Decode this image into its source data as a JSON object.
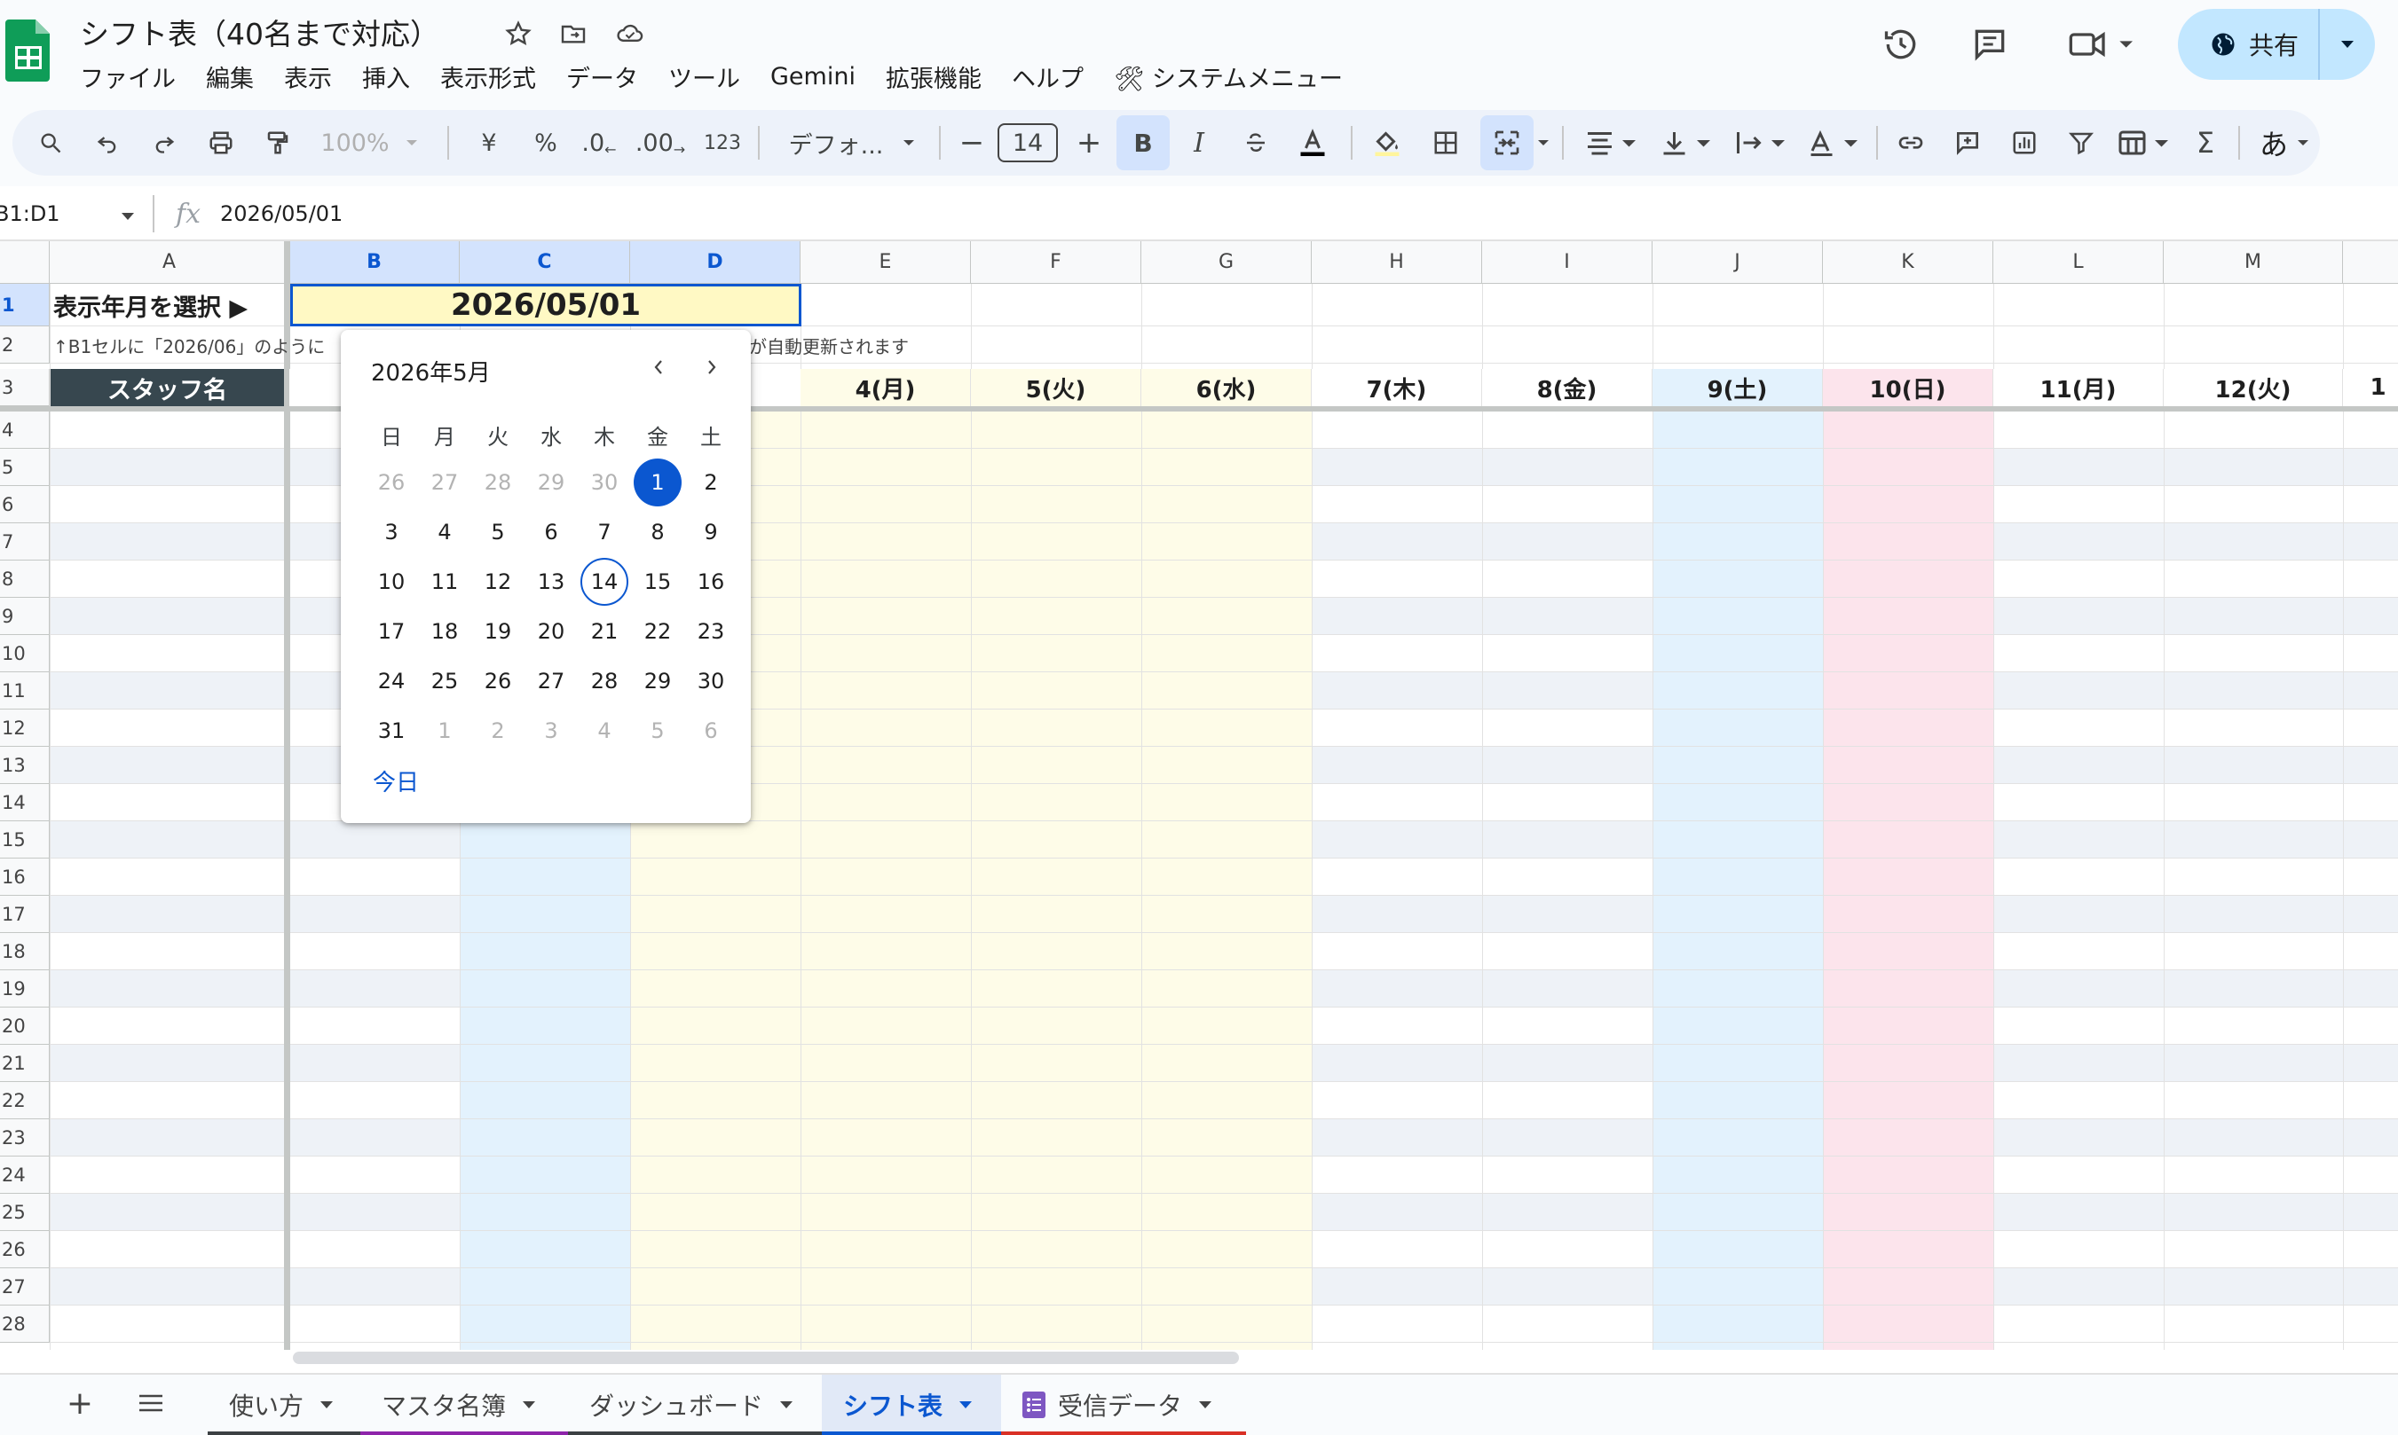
{
  "title": "シフト表（40名まで対応）",
  "menu": [
    "ファイル",
    "編集",
    "表示",
    "挿入",
    "表示形式",
    "データ",
    "ツール",
    "Gemini",
    "拡張機能",
    "ヘルプ",
    "🛠 システムメニュー"
  ],
  "share_label": "共有",
  "toolbar": {
    "zoom": "100%",
    "currency": "¥",
    "percent": "%",
    "dec_decrease": ".0",
    "dec_increase": ".00",
    "number_format": "123",
    "font": "デフォ...",
    "font_size": "14",
    "bold": "B",
    "italic": "I",
    "input_tool": "あ"
  },
  "formula_bar": {
    "name_box": "B1:D1",
    "fx": "fx",
    "value": "2026/05/01"
  },
  "columns": [
    "A",
    "B",
    "C",
    "D",
    "E",
    "F",
    "G",
    "H",
    "I",
    "J",
    "K",
    "L",
    "M"
  ],
  "rows": [
    "1",
    "2",
    "3",
    "4",
    "5",
    "6",
    "7",
    "8",
    "9",
    "10",
    "11",
    "12",
    "13",
    "14",
    "15",
    "16",
    "17",
    "18",
    "19",
    "20",
    "21",
    "22",
    "23",
    "24",
    "25",
    "26",
    "27",
    "28"
  ],
  "sheet": {
    "a1_label": "表示年月を選択 ▶",
    "b1_value": "2026/05/01",
    "row2_note_left": "↑B1セルに「2026/06」のように",
    "row2_note_right": "が自動更新されます",
    "staff_header": "スタッフ名",
    "day_headers": [
      "4(月)",
      "5(火)",
      "6(水)",
      "7(木)",
      "8(金)",
      "9(土)",
      "10(日)",
      "11(月)",
      "12(火)",
      "1"
    ]
  },
  "calendar": {
    "month_label": "2026年5月",
    "weekdays": [
      "日",
      "月",
      "火",
      "水",
      "木",
      "金",
      "土"
    ],
    "weeks": [
      [
        "26",
        "27",
        "28",
        "29",
        "30",
        "1",
        "2"
      ],
      [
        "3",
        "4",
        "5",
        "6",
        "7",
        "8",
        "9"
      ],
      [
        "10",
        "11",
        "12",
        "13",
        "14",
        "15",
        "16"
      ],
      [
        "17",
        "18",
        "19",
        "20",
        "21",
        "22",
        "23"
      ],
      [
        "24",
        "25",
        "26",
        "27",
        "28",
        "29",
        "30"
      ],
      [
        "31",
        "1",
        "2",
        "3",
        "4",
        "5",
        "6"
      ]
    ],
    "selected": "1",
    "today": "14",
    "today_button": "今日",
    "selected_color": "#0b57d0"
  },
  "tabs": [
    {
      "label": "使い方",
      "color": "#3c4043"
    },
    {
      "label": "マスタ名簿",
      "color": "#8e24aa"
    },
    {
      "label": "ダッシュボード",
      "color": "#3c4043"
    },
    {
      "label": "シフト表",
      "color": "#0b57d0",
      "active": true
    },
    {
      "label": "受信データ",
      "color": "#d93025"
    }
  ],
  "colors": {
    "accent": "#0b57d0",
    "yellow_band": "#fefce8",
    "blue_band": "#e3f2fd",
    "pink_band": "#fce4ec",
    "staff_header_bg": "#37474f"
  }
}
